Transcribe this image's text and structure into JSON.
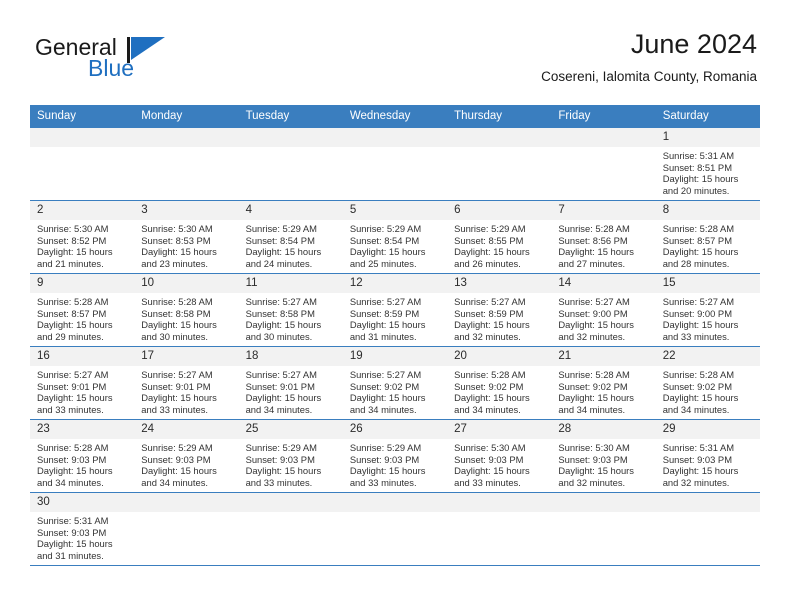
{
  "brand": {
    "word_general": "General",
    "word_blue": "Blue",
    "flag_icon": "triangle-flag-icon"
  },
  "header": {
    "month_title": "June 2024",
    "location": "Cosereni, Ialomita County, Romania"
  },
  "colors": {
    "header_blue": "#3a7ebf",
    "daynum_band": "#f2f2f2",
    "brand_blue": "#1f6fc0",
    "text": "#333333"
  },
  "calendar": {
    "weekday_headers": [
      "Sunday",
      "Monday",
      "Tuesday",
      "Wednesday",
      "Thursday",
      "Friday",
      "Saturday"
    ],
    "weeks": [
      [
        {
          "day": "",
          "empty": true
        },
        {
          "day": "",
          "empty": true
        },
        {
          "day": "",
          "empty": true
        },
        {
          "day": "",
          "empty": true
        },
        {
          "day": "",
          "empty": true
        },
        {
          "day": "",
          "empty": true
        },
        {
          "day": "1",
          "sunrise": "Sunrise: 5:31 AM",
          "sunset": "Sunset: 8:51 PM",
          "daylight1": "Daylight: 15 hours",
          "daylight2": "and 20 minutes."
        }
      ],
      [
        {
          "day": "2",
          "sunrise": "Sunrise: 5:30 AM",
          "sunset": "Sunset: 8:52 PM",
          "daylight1": "Daylight: 15 hours",
          "daylight2": "and 21 minutes."
        },
        {
          "day": "3",
          "sunrise": "Sunrise: 5:30 AM",
          "sunset": "Sunset: 8:53 PM",
          "daylight1": "Daylight: 15 hours",
          "daylight2": "and 23 minutes."
        },
        {
          "day": "4",
          "sunrise": "Sunrise: 5:29 AM",
          "sunset": "Sunset: 8:54 PM",
          "daylight1": "Daylight: 15 hours",
          "daylight2": "and 24 minutes."
        },
        {
          "day": "5",
          "sunrise": "Sunrise: 5:29 AM",
          "sunset": "Sunset: 8:54 PM",
          "daylight1": "Daylight: 15 hours",
          "daylight2": "and 25 minutes."
        },
        {
          "day": "6",
          "sunrise": "Sunrise: 5:29 AM",
          "sunset": "Sunset: 8:55 PM",
          "daylight1": "Daylight: 15 hours",
          "daylight2": "and 26 minutes."
        },
        {
          "day": "7",
          "sunrise": "Sunrise: 5:28 AM",
          "sunset": "Sunset: 8:56 PM",
          "daylight1": "Daylight: 15 hours",
          "daylight2": "and 27 minutes."
        },
        {
          "day": "8",
          "sunrise": "Sunrise: 5:28 AM",
          "sunset": "Sunset: 8:57 PM",
          "daylight1": "Daylight: 15 hours",
          "daylight2": "and 28 minutes."
        }
      ],
      [
        {
          "day": "9",
          "sunrise": "Sunrise: 5:28 AM",
          "sunset": "Sunset: 8:57 PM",
          "daylight1": "Daylight: 15 hours",
          "daylight2": "and 29 minutes."
        },
        {
          "day": "10",
          "sunrise": "Sunrise: 5:28 AM",
          "sunset": "Sunset: 8:58 PM",
          "daylight1": "Daylight: 15 hours",
          "daylight2": "and 30 minutes."
        },
        {
          "day": "11",
          "sunrise": "Sunrise: 5:27 AM",
          "sunset": "Sunset: 8:58 PM",
          "daylight1": "Daylight: 15 hours",
          "daylight2": "and 30 minutes."
        },
        {
          "day": "12",
          "sunrise": "Sunrise: 5:27 AM",
          "sunset": "Sunset: 8:59 PM",
          "daylight1": "Daylight: 15 hours",
          "daylight2": "and 31 minutes."
        },
        {
          "day": "13",
          "sunrise": "Sunrise: 5:27 AM",
          "sunset": "Sunset: 8:59 PM",
          "daylight1": "Daylight: 15 hours",
          "daylight2": "and 32 minutes."
        },
        {
          "day": "14",
          "sunrise": "Sunrise: 5:27 AM",
          "sunset": "Sunset: 9:00 PM",
          "daylight1": "Daylight: 15 hours",
          "daylight2": "and 32 minutes."
        },
        {
          "day": "15",
          "sunrise": "Sunrise: 5:27 AM",
          "sunset": "Sunset: 9:00 PM",
          "daylight1": "Daylight: 15 hours",
          "daylight2": "and 33 minutes."
        }
      ],
      [
        {
          "day": "16",
          "sunrise": "Sunrise: 5:27 AM",
          "sunset": "Sunset: 9:01 PM",
          "daylight1": "Daylight: 15 hours",
          "daylight2": "and 33 minutes."
        },
        {
          "day": "17",
          "sunrise": "Sunrise: 5:27 AM",
          "sunset": "Sunset: 9:01 PM",
          "daylight1": "Daylight: 15 hours",
          "daylight2": "and 33 minutes."
        },
        {
          "day": "18",
          "sunrise": "Sunrise: 5:27 AM",
          "sunset": "Sunset: 9:01 PM",
          "daylight1": "Daylight: 15 hours",
          "daylight2": "and 34 minutes."
        },
        {
          "day": "19",
          "sunrise": "Sunrise: 5:27 AM",
          "sunset": "Sunset: 9:02 PM",
          "daylight1": "Daylight: 15 hours",
          "daylight2": "and 34 minutes."
        },
        {
          "day": "20",
          "sunrise": "Sunrise: 5:28 AM",
          "sunset": "Sunset: 9:02 PM",
          "daylight1": "Daylight: 15 hours",
          "daylight2": "and 34 minutes."
        },
        {
          "day": "21",
          "sunrise": "Sunrise: 5:28 AM",
          "sunset": "Sunset: 9:02 PM",
          "daylight1": "Daylight: 15 hours",
          "daylight2": "and 34 minutes."
        },
        {
          "day": "22",
          "sunrise": "Sunrise: 5:28 AM",
          "sunset": "Sunset: 9:02 PM",
          "daylight1": "Daylight: 15 hours",
          "daylight2": "and 34 minutes."
        }
      ],
      [
        {
          "day": "23",
          "sunrise": "Sunrise: 5:28 AM",
          "sunset": "Sunset: 9:03 PM",
          "daylight1": "Daylight: 15 hours",
          "daylight2": "and 34 minutes."
        },
        {
          "day": "24",
          "sunrise": "Sunrise: 5:29 AM",
          "sunset": "Sunset: 9:03 PM",
          "daylight1": "Daylight: 15 hours",
          "daylight2": "and 34 minutes."
        },
        {
          "day": "25",
          "sunrise": "Sunrise: 5:29 AM",
          "sunset": "Sunset: 9:03 PM",
          "daylight1": "Daylight: 15 hours",
          "daylight2": "and 33 minutes."
        },
        {
          "day": "26",
          "sunrise": "Sunrise: 5:29 AM",
          "sunset": "Sunset: 9:03 PM",
          "daylight1": "Daylight: 15 hours",
          "daylight2": "and 33 minutes."
        },
        {
          "day": "27",
          "sunrise": "Sunrise: 5:30 AM",
          "sunset": "Sunset: 9:03 PM",
          "daylight1": "Daylight: 15 hours",
          "daylight2": "and 33 minutes."
        },
        {
          "day": "28",
          "sunrise": "Sunrise: 5:30 AM",
          "sunset": "Sunset: 9:03 PM",
          "daylight1": "Daylight: 15 hours",
          "daylight2": "and 32 minutes."
        },
        {
          "day": "29",
          "sunrise": "Sunrise: 5:31 AM",
          "sunset": "Sunset: 9:03 PM",
          "daylight1": "Daylight: 15 hours",
          "daylight2": "and 32 minutes."
        }
      ],
      [
        {
          "day": "30",
          "sunrise": "Sunrise: 5:31 AM",
          "sunset": "Sunset: 9:03 PM",
          "daylight1": "Daylight: 15 hours",
          "daylight2": "and 31 minutes."
        },
        {
          "day": "",
          "empty": true
        },
        {
          "day": "",
          "empty": true
        },
        {
          "day": "",
          "empty": true
        },
        {
          "day": "",
          "empty": true
        },
        {
          "day": "",
          "empty": true
        },
        {
          "day": "",
          "empty": true
        }
      ]
    ]
  }
}
